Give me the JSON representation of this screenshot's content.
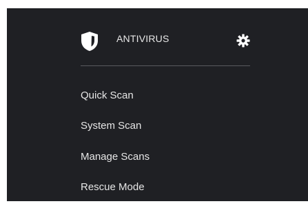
{
  "header": {
    "title": "ANTIVIRUS",
    "shield_icon": "shield-icon",
    "settings_icon": "gear-icon"
  },
  "menu": {
    "items": [
      {
        "label": "Quick Scan"
      },
      {
        "label": "System Scan"
      },
      {
        "label": "Manage Scans"
      },
      {
        "label": "Rescue Mode"
      }
    ]
  },
  "colors": {
    "panel_background": "#1f2024",
    "text": "#e6e6e6",
    "divider": "#5a5b60",
    "icon": "#ffffff"
  }
}
